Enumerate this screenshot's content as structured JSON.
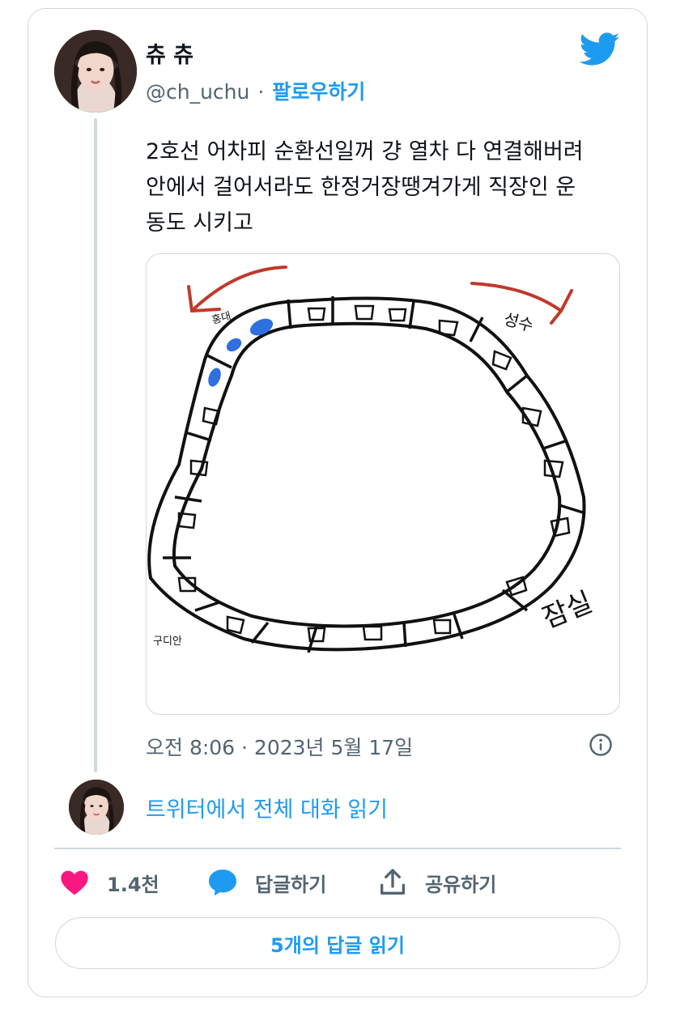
{
  "author": {
    "display_name": "츄 츄",
    "handle": "@ch_uchu",
    "separator": "·",
    "follow_label": "팔로우하기"
  },
  "tweet": {
    "lines": [
      "2호선 어차피 순환선일꺼 걍 열차 다 연결해버려",
      "안에서 걸어서라도 한정거장땡겨가게 직장인 운",
      "동도 시키고"
    ],
    "timestamp": "오전 8:06 · 2023년 5월 17일"
  },
  "drawing": {
    "labels": {
      "hongdae": "홍대",
      "seongsu": "성수",
      "jamsil": "잠실",
      "guro": "구디안"
    },
    "colors": {
      "arrow": "#c0392b",
      "passengers": "#2f6fe0",
      "stroke": "#111111"
    }
  },
  "conversation": {
    "read_label": "트위터에서 전체 대화 읽기"
  },
  "actions": {
    "like_count": "1.4천",
    "reply_label": "답글하기",
    "share_label": "공유하기",
    "read_replies_label": "5개의 답글 읽기"
  },
  "colors": {
    "accent": "#1d9bf0",
    "like": "#f91880",
    "muted": "#536471",
    "border": "#cfd9de"
  },
  "icons": {
    "brand": "twitter-bird-icon",
    "info": "info-icon",
    "like": "heart-icon",
    "reply": "speech-bubble-icon",
    "share": "share-icon"
  }
}
